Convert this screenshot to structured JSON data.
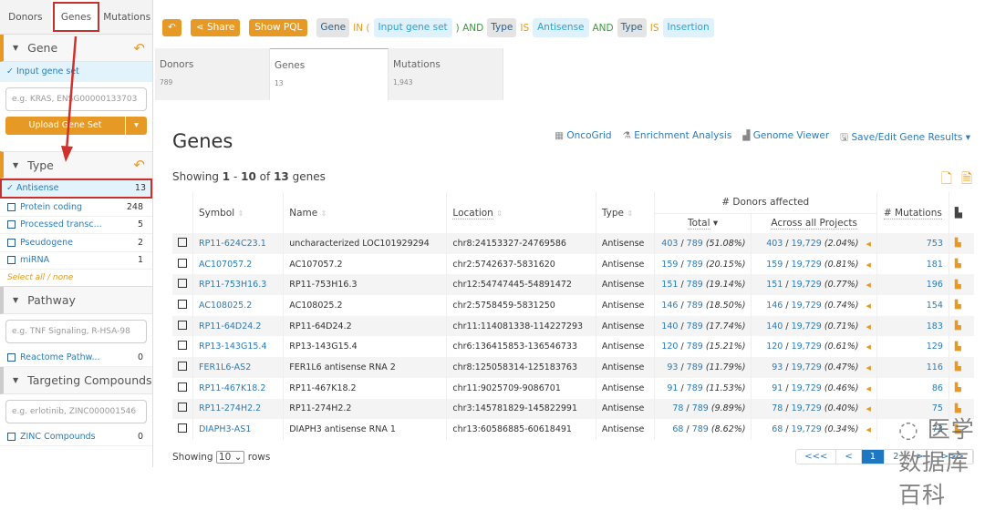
{
  "sidebar": {
    "tabs": [
      "Donors",
      "Genes",
      "Mutations"
    ],
    "gene": {
      "title": "Gene",
      "selected": "Input gene set",
      "placeholder": "e.g. KRAS, ENSG00000133703",
      "upload": "Upload Gene Set"
    },
    "type": {
      "title": "Type",
      "selected": {
        "label": "Antisense",
        "count": "13"
      },
      "terms": [
        {
          "label": "Protein coding",
          "count": "248"
        },
        {
          "label": "Processed transc...",
          "count": "5"
        },
        {
          "label": "Pseudogene",
          "count": "2"
        },
        {
          "label": "miRNA",
          "count": "1"
        }
      ],
      "select_all": "Select all / none"
    },
    "pathway": {
      "title": "Pathway",
      "placeholder": "e.g. TNF Signaling, R-HSA-98",
      "term": {
        "label": "Reactome Pathw...",
        "count": "0"
      }
    },
    "compounds": {
      "title": "Targeting Compounds",
      "placeholder": "e.g. erlotinib, ZINC000001546",
      "term": {
        "label": "ZINC Compounds",
        "count": "0"
      }
    }
  },
  "toolbar": {
    "share": "Share",
    "show_pql": "Show PQL",
    "pql": [
      {
        "k": "f",
        "t": "Gene"
      },
      {
        "k": "o",
        "t": "IN ("
      },
      {
        "k": "v",
        "t": "Input gene set"
      },
      {
        "k": "a",
        "t": ") AND"
      },
      {
        "k": "f",
        "t": "Type"
      },
      {
        "k": "o",
        "t": "IS"
      },
      {
        "k": "v",
        "t": "Antisense"
      },
      {
        "k": "a",
        "t": "AND"
      },
      {
        "k": "f",
        "t": "Type"
      },
      {
        "k": "o",
        "t": "IS"
      },
      {
        "k": "v",
        "t": "Insertion"
      }
    ]
  },
  "tabs": [
    {
      "label": "Donors",
      "count": "789"
    },
    {
      "label": "Genes",
      "count": "13"
    },
    {
      "label": "Mutations",
      "count": "1,943"
    }
  ],
  "title": "Genes",
  "links": [
    "OncoGrid",
    "Enrichment Analysis",
    "Genome Viewer",
    "Save/Edit Gene Results"
  ],
  "showing": {
    "prefix": "Showing",
    "from": "1",
    "sep": "-",
    "to": "10",
    "of": "of",
    "total": "13",
    "suffix": "genes"
  },
  "table": {
    "headers": {
      "symbol": "Symbol",
      "name": "Name",
      "location": "Location",
      "type": "Type",
      "donors": "# Donors affected",
      "total": "Total",
      "across": "Across all Projects",
      "mutations": "# Mutations"
    },
    "rows": [
      [
        "RP11-624C23.1",
        "uncharacterized LOC101929294",
        "chr8:24153327-24769586",
        "Antisense",
        "403",
        "789",
        "(51.08%)",
        "403",
        "19,729",
        "(2.04%)",
        "753"
      ],
      [
        "AC107057.2",
        "AC107057.2",
        "chr2:5742637-5831620",
        "Antisense",
        "159",
        "789",
        "(20.15%)",
        "159",
        "19,729",
        "(0.81%)",
        "181"
      ],
      [
        "RP11-753H16.3",
        "RP11-753H16.3",
        "chr12:54747445-54891472",
        "Antisense",
        "151",
        "789",
        "(19.14%)",
        "151",
        "19,729",
        "(0.77%)",
        "196"
      ],
      [
        "AC108025.2",
        "AC108025.2",
        "chr2:5758459-5831250",
        "Antisense",
        "146",
        "789",
        "(18.50%)",
        "146",
        "19,729",
        "(0.74%)",
        "154"
      ],
      [
        "RP11-64D24.2",
        "RP11-64D24.2",
        "chr11:114081338-114227293",
        "Antisense",
        "140",
        "789",
        "(17.74%)",
        "140",
        "19,729",
        "(0.71%)",
        "183"
      ],
      [
        "RP13-143G15.4",
        "RP13-143G15.4",
        "chr6:136415853-136546733",
        "Antisense",
        "120",
        "789",
        "(15.21%)",
        "120",
        "19,729",
        "(0.61%)",
        "129"
      ],
      [
        "FER1L6-AS2",
        "FER1L6 antisense RNA 2",
        "chr8:125058314-125183763",
        "Antisense",
        "93",
        "789",
        "(11.79%)",
        "93",
        "19,729",
        "(0.47%)",
        "116"
      ],
      [
        "RP11-467K18.2",
        "RP11-467K18.2",
        "chr11:9025709-9086701",
        "Antisense",
        "91",
        "789",
        "(11.53%)",
        "91",
        "19,729",
        "(0.46%)",
        "86"
      ],
      [
        "RP11-274H2.2",
        "RP11-274H2.2",
        "chr3:145781829-145822991",
        "Antisense",
        "78",
        "789",
        "(9.89%)",
        "78",
        "19,729",
        "(0.40%)",
        "75"
      ],
      [
        "DIAPH3-AS1",
        "DIAPH3 antisense RNA 1",
        "chr13:60586885-60618491",
        "Antisense",
        "68",
        "789",
        "(8.62%)",
        "68",
        "19,729",
        "(0.34%)",
        "73"
      ]
    ]
  },
  "footer": {
    "showing": "Showing",
    "size": "10",
    "rows": "rows",
    "pages": [
      "<<<",
      "<",
      "1",
      "2",
      ">",
      ">>>"
    ],
    "current": "1"
  },
  "watermark": "医学数据库百科",
  "colors": {
    "accent": "#e69a25",
    "link": "#2b7bb9",
    "highlight": "#c9302c"
  }
}
